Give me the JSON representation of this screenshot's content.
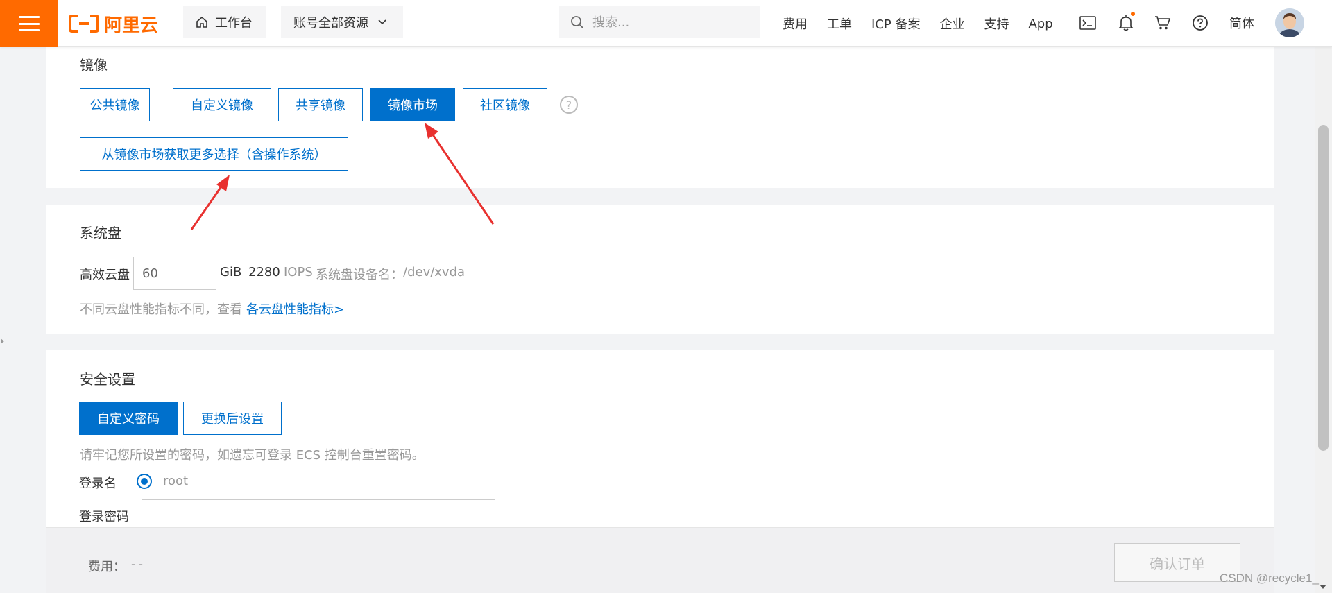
{
  "header": {
    "brand": "阿里云",
    "workbench_label": "工作台",
    "resources_label": "账号全部资源",
    "search_placeholder": "搜索...",
    "links": [
      "费用",
      "工单",
      "ICP 备案",
      "企业",
      "支持",
      "App"
    ],
    "language": "简体"
  },
  "image_section": {
    "title": "镜像",
    "tabs": [
      "公共镜像",
      "自定义镜像",
      "共享镜像",
      "镜像市场",
      "社区镜像"
    ],
    "active_tab": "镜像市场",
    "help": "?",
    "market_button": "从镜像市场获取更多选择（含操作系统）"
  },
  "disk_section": {
    "title": "系统盘",
    "disk_type": "高效云盘",
    "size_value": "60",
    "unit": "GiB",
    "iops_value": "2280",
    "iops_label": "IOPS",
    "device_label": "系统盘设备名：",
    "device_name": "/dev/xvda",
    "note": "不同云盘性能指标不同，查看",
    "note_link": "各云盘性能指标>"
  },
  "security_section": {
    "title": "安全设置",
    "options": [
      "自定义密码",
      "更换后设置"
    ],
    "active_option": "自定义密码",
    "hint": "请牢记您所设置的密码，如遗忘可登录 ECS 控制台重置密码。",
    "login_name_label": "登录名",
    "login_name_value": "root",
    "password_label": "登录密码",
    "password_value": ""
  },
  "footer": {
    "fee_label": "费用：",
    "fee_value": "--",
    "confirm_label": "确认订单"
  },
  "watermark": "CSDN @recycle1_",
  "colors": {
    "brand_orange": "#ff6a00",
    "primary_blue": "#0070cc",
    "annotation_red": "#e8312f"
  }
}
